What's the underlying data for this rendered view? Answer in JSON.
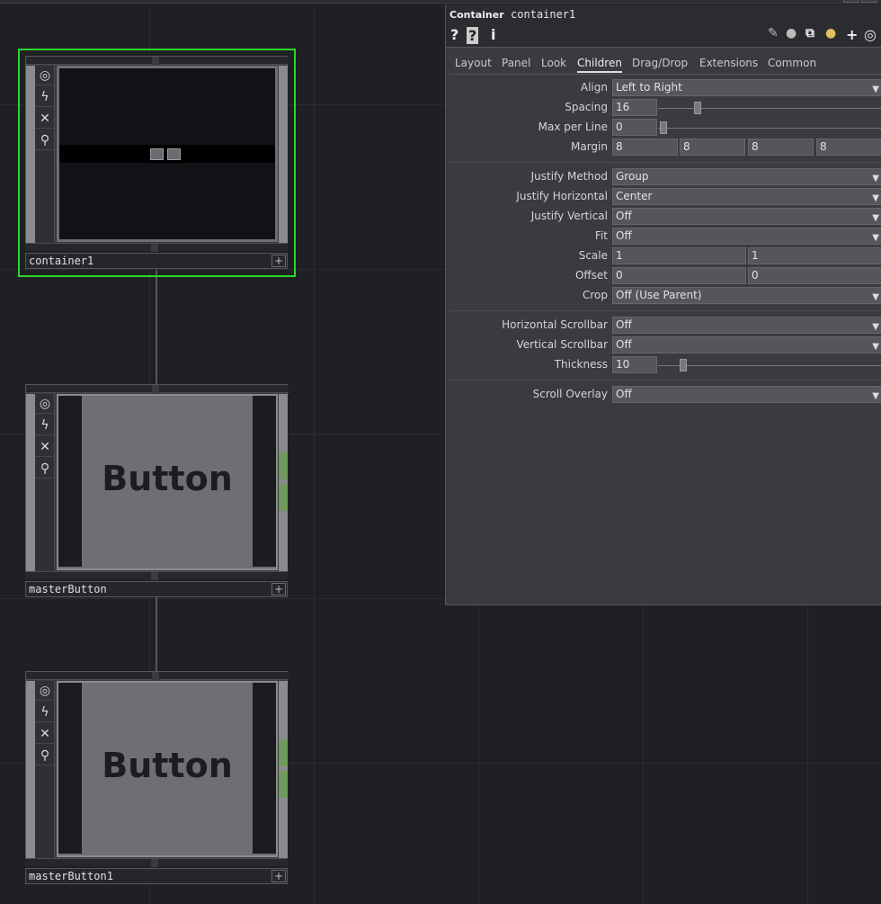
{
  "network": {
    "nodes": [
      {
        "name": "container1"
      },
      {
        "name": "masterButton",
        "button_text": "Button"
      },
      {
        "name": "masterButton1",
        "button_text": "Button"
      }
    ],
    "plus": "+"
  },
  "panel": {
    "op_type": "Container",
    "op_name": "container1",
    "toolbar_left": [
      "?",
      "?",
      "i"
    ],
    "tabs": [
      "Layout",
      "Panel",
      "Look",
      "Children",
      "Drag/Drop",
      "Extensions",
      "Common"
    ],
    "active_tab": "Children",
    "params": {
      "align": {
        "label": "Align",
        "value": "Left to Right"
      },
      "spacing": {
        "label": "Spacing",
        "value": "16"
      },
      "max_per_line": {
        "label": "Max per Line",
        "value": "0"
      },
      "margin": {
        "label": "Margin",
        "values": [
          "8",
          "8",
          "8",
          "8"
        ]
      },
      "justify_method": {
        "label": "Justify Method",
        "value": "Group"
      },
      "justify_horizontal": {
        "label": "Justify Horizontal",
        "value": "Center"
      },
      "justify_vertical": {
        "label": "Justify Vertical",
        "value": "Off"
      },
      "fit": {
        "label": "Fit",
        "value": "Off"
      },
      "scale": {
        "label": "Scale",
        "values": [
          "1",
          "1"
        ]
      },
      "offset": {
        "label": "Offset",
        "values": [
          "0",
          "0"
        ]
      },
      "crop": {
        "label": "Crop",
        "value": "Off (Use Parent)"
      },
      "horizontal_scrollbar": {
        "label": "Horizontal Scrollbar",
        "value": "Off"
      },
      "vertical_scrollbar": {
        "label": "Vertical Scrollbar",
        "value": "Off"
      },
      "thickness": {
        "label": "Thickness",
        "value": "10"
      },
      "scroll_overlay": {
        "label": "Scroll Overlay",
        "value": "Off"
      }
    }
  },
  "colors": {
    "selected": "#2bd62b",
    "green_handle": "#6f9a5c",
    "bg": "#1f2024"
  }
}
